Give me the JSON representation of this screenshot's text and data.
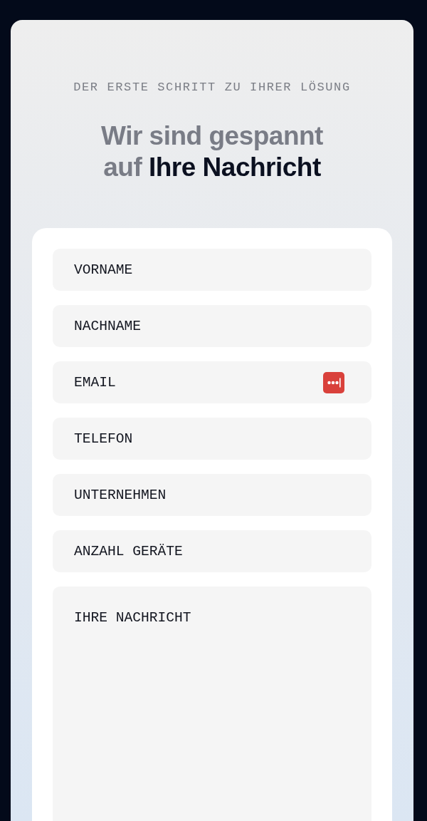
{
  "eyebrow": "DER ERSTE SCHRITT ZU IHRER LÖSUNG",
  "heading": {
    "lines": [
      [
        {
          "text": "Wir sind gespannt",
          "highlighted": false
        }
      ],
      [
        {
          "text": "auf",
          "highlighted": false
        },
        {
          "text": "Ihre Nachricht",
          "highlighted": true
        }
      ]
    ]
  },
  "form": {
    "fields": [
      {
        "kind": "input",
        "placeholder": "VORNAME"
      },
      {
        "kind": "input",
        "placeholder": "NACHNAME"
      },
      {
        "kind": "input",
        "placeholder": "EMAIL",
        "autofill_icon": true
      },
      {
        "kind": "input",
        "placeholder": "TELEFON"
      },
      {
        "kind": "input",
        "placeholder": "UNTERNEHMEN"
      },
      {
        "kind": "input",
        "placeholder": "ANZAHL GERÄTE"
      },
      {
        "kind": "textarea",
        "placeholder": "IHRE NACHRICHT"
      }
    ]
  }
}
